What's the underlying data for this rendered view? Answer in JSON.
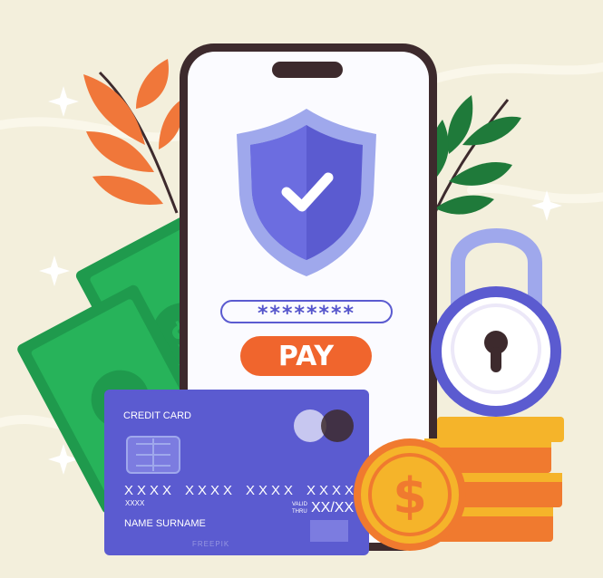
{
  "phone": {
    "password_mask": "********",
    "pay_label": "PAY"
  },
  "card": {
    "title": "CREDIT CARD",
    "number_groups": [
      "XXXX",
      "XXXX",
      "XXXX",
      "XXXX"
    ],
    "number_sub": "XXXX",
    "valid_label_line1": "VALID",
    "valid_label_line2": "THRU",
    "valid_value": "XX/XX",
    "holder_name": "NAME SURNAME"
  },
  "watermark": "FREEPIK",
  "icons": [
    "shield-check-icon",
    "padlock-icon",
    "dollar-coin-icon",
    "banknote-icon",
    "card-chip-icon",
    "sparkle-icon",
    "leaf-icon"
  ],
  "colors": {
    "background": "#f3efdc",
    "phone_frame": "#3d2a2d",
    "shield": "#5b5bd0",
    "card": "#5b5bd0",
    "pay_button": "#f0652d",
    "coin": "#f5b42a",
    "money": "#1f9a4d"
  }
}
